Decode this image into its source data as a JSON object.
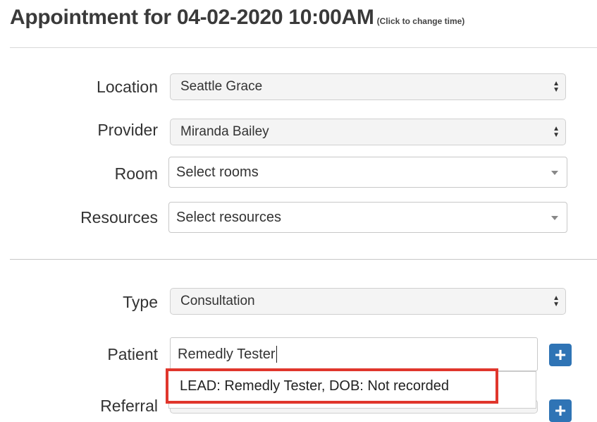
{
  "header": {
    "title": "Appointment for 04-02-2020 10:00AM",
    "hint": "(Click to change time)"
  },
  "form": {
    "location": {
      "label": "Location",
      "value": "Seattle Grace"
    },
    "provider": {
      "label": "Provider",
      "value": "Miranda Bailey"
    },
    "room": {
      "label": "Room",
      "placeholder": "Select rooms"
    },
    "resources": {
      "label": "Resources",
      "placeholder": "Select resources"
    },
    "type": {
      "label": "Type",
      "value": "Consultation"
    },
    "patient": {
      "label": "Patient",
      "value": "Remedly Tester",
      "suggestion": "LEAD: Remedly Tester, DOB: Not recorded"
    },
    "referral": {
      "label": "Referral"
    }
  },
  "icons": {
    "plus": "+",
    "select_arrows": "▲▼"
  },
  "colors": {
    "accent": "#2f74b5",
    "highlight": "#e0362c"
  }
}
